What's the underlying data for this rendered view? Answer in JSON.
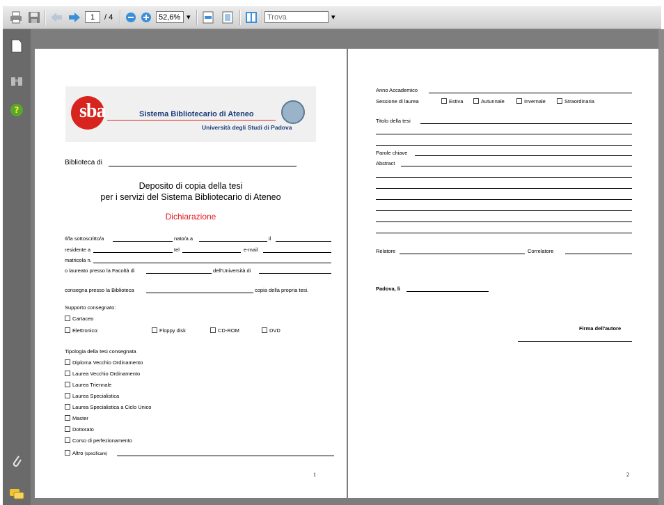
{
  "toolbar": {
    "page_current": "1",
    "page_total": "/ 4",
    "zoom": "52,6%",
    "search_placeholder": "Trova",
    "icons": [
      "print-icon",
      "save-icon",
      "prev-page-icon",
      "next-page-icon",
      "zoom-out-icon",
      "zoom-in-icon",
      "fit-width-icon",
      "fit-page-icon",
      "two-page-icon"
    ]
  },
  "leftpanel": {
    "icons": [
      "pages-icon",
      "bookmarks-icon",
      "help-icon",
      "attachment-icon",
      "comments-icon"
    ]
  },
  "page1": {
    "logo": {
      "letters": "sba",
      "title": "Sistema Bibliotecario di Ateneo",
      "subtitle": "Università degli Studi di Padova"
    },
    "biblioteca_label": "Biblioteca di",
    "heading1": "Deposito di copia della tesi",
    "heading2": "per i servizi del Sistema Bibliotecario di Ateneo",
    "dichiarazione": "Dichiarazione",
    "sottoscritto": "Il/la sottoscritto/a",
    "nato": "nato/a a",
    "il": "il",
    "residente": "residente a",
    "tel": "tel",
    "email": "e-mail",
    "matricola": "matricola n.",
    "laureato": "o laureato presso la Facoltà di",
    "universita": "dell'Università di",
    "consegna": "consegna presso la Biblioteca",
    "copia": "copia della propria tesi.",
    "supporto_title": "Supporto consegnato:",
    "cartaceo": "Cartaceo",
    "elettronico": "Elettronico:",
    "floppy": "Floppy disk",
    "cdrom": "CD-ROM",
    "dvd": "DVD",
    "tipologia_title": "Tipologia della tesi consegnata",
    "tipologie": [
      "Diploma Vecchio Ordinamento",
      "Laurea Vecchio Ordinamento",
      "Laurea Triennale",
      "Laurea Specialistica",
      "Laurea Specialistica a Ciclo Unico",
      "Master",
      "Dottorato",
      "Corso di perfezionamento"
    ],
    "altro": "Altro",
    "altro_note": "(specificare)",
    "page_number": "1"
  },
  "page2": {
    "anno": "Anno Accademico",
    "sessione": "Sessione di laurea",
    "sessioni": [
      "Estiva",
      "Autunnale",
      "Invernale",
      "Straordinaria"
    ],
    "titolo": "Titolo della tesi",
    "parole": "Parole chiave",
    "abstract": "Abstract",
    "relatore": "Relatore",
    "correlatore": "Correlatore",
    "padova": "Padova, lì",
    "firma": "Firma dell'autore",
    "page_number": "2"
  }
}
